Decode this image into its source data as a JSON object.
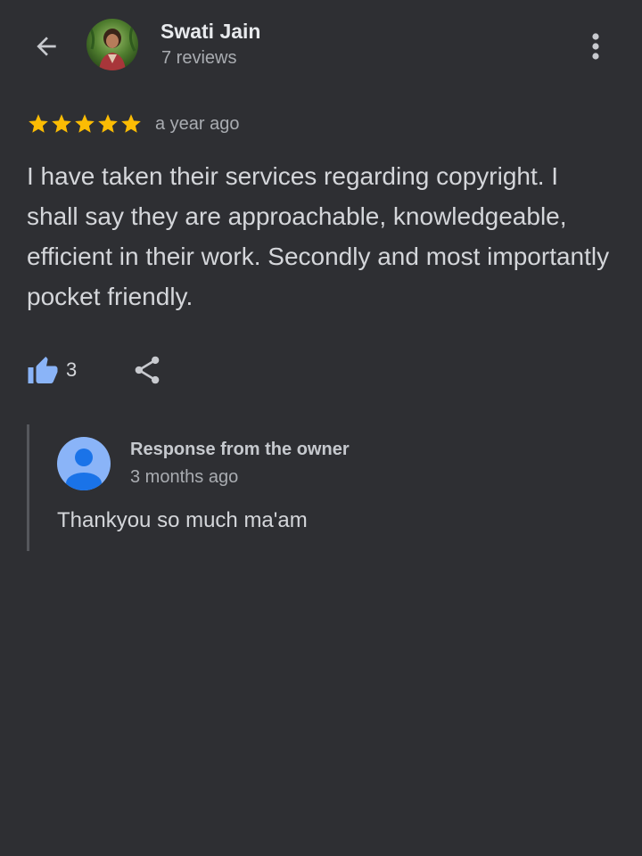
{
  "header": {
    "reviewer_name": "Swati Jain",
    "review_count": "7 reviews"
  },
  "review": {
    "rating": 5,
    "rating_max": 5,
    "date": "a year ago",
    "text": "I have taken their services regarding copyright. I shall say they are approachable, knowledgeable, efficient in their work. Secondly and most importantly pocket friendly.",
    "likes": "3"
  },
  "response": {
    "label": "Response from the owner",
    "date": "3 months ago",
    "text": "Thankyou so much ma'am"
  },
  "icons": {
    "back": "arrow-back-icon",
    "more": "more-vert-icon",
    "star": "star-icon",
    "like": "thumb-up-icon",
    "share": "share-icon",
    "owner_avatar": "person-icon"
  },
  "colors": {
    "background": "#2e2f33",
    "star": "#fbbc04",
    "like_icon": "#8ab4f8",
    "owner_avatar_bg": "#8ab4f8",
    "owner_avatar_fg": "#1a73e8"
  }
}
